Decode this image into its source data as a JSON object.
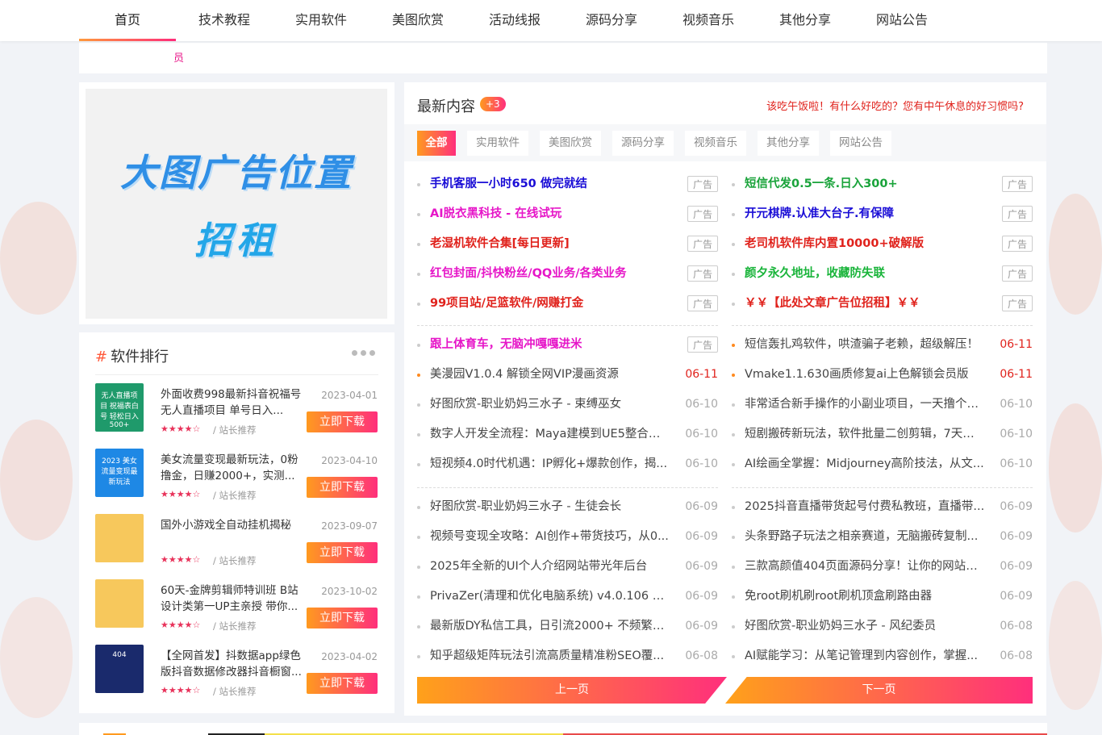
{
  "nav": {
    "items": [
      "首页",
      "技术教程",
      "实用软件",
      "美图欣赏",
      "活动线报",
      "源码分享",
      "视频音乐",
      "其他分享",
      "网站公告"
    ],
    "active_index": 0
  },
  "notice": {
    "text": "员"
  },
  "ad": {
    "line1": "大图广告位置",
    "line2": "招租"
  },
  "ranking": {
    "title": "软件排行",
    "hash": "#",
    "button_label": "立即下载",
    "stars": "★★★★☆",
    "rec_label": "/ 站长推荐",
    "items": [
      {
        "title": "外面收费998最新抖音祝福号无人直播项目 单号日入...",
        "date": "2023-04-01",
        "thumb_text": "无人直播项目 祝福表白号 轻松日入500+",
        "thumb_color": "#1f9a6b"
      },
      {
        "title": "美女流量变现最新玩法，0粉撸金，日赚2000+，实测...",
        "date": "2023-04-10",
        "thumb_text": "2023 美女流量变现最新玩法",
        "thumb_color": "#1e88e5"
      },
      {
        "title": "国外小游戏全自动挂机揭秘",
        "date": "2023-09-07",
        "thumb_text": "",
        "thumb_color": "#f7c85c"
      },
      {
        "title": "60天-金牌剪辑师特训班 B站设计类第一UP主亲授 带你...",
        "date": "2023-10-02",
        "thumb_text": "",
        "thumb_color": "#f7c85c"
      },
      {
        "title": "【全网首发】抖数据app绿色版抖音数据修改器抖音橱窗...",
        "date": "2023-04-02",
        "thumb_text": "404",
        "thumb_color": "#1a2a6c"
      }
    ]
  },
  "main": {
    "title": "最新内容",
    "badge": "+3",
    "tip": "该吃午饭啦！有什么好吃的？您有中午休息的好习惯吗?",
    "filters": [
      "全部",
      "实用软件",
      "美图欣赏",
      "源码分享",
      "视频音乐",
      "其他分享",
      "网站公告"
    ],
    "active_filter": 0,
    "ad_tag": "广告",
    "ads_left": [
      {
        "text": "手机客服一小时650 做完就结",
        "color": "#1a0dd6"
      },
      {
        "text": "AI脱衣黑科技 - 在线试玩",
        "color": "#e616c8"
      },
      {
        "text": "老湿机软件合集[每日更新]",
        "color": "#e0221c"
      },
      {
        "text": "红包封面/抖快粉丝/QQ业务/各类业务",
        "color": "#e616c8"
      },
      {
        "text": "99项目站/足篮软件/网赚打金",
        "color": "#e0221c"
      }
    ],
    "ads_right": [
      {
        "text": "短信代发0.5一条.日入300+",
        "color": "#19a33a"
      },
      {
        "text": "开元棋牌.认准大台子.有保障",
        "color": "#1a0dd6"
      },
      {
        "text": "老司机软件库内置10000+破解版",
        "color": "#e0221c"
      },
      {
        "text": "颜夕永久地址，收藏防失联",
        "color": "#19b43a"
      },
      {
        "text": "￥￥【此处文章广告位招租】￥￥",
        "color": "#e0221c"
      }
    ],
    "left_list_a": [
      {
        "text": "跟上体育车，无脑冲嘎嘎进米",
        "date": "",
        "ad": true,
        "color": "#e616c8"
      },
      {
        "text": "美漫园V1.0.4 解锁全网VIP漫画资源",
        "date": "06-11",
        "hot": true
      },
      {
        "text": "好图欣赏-职业奶妈三水子 - 束缚巫女",
        "date": "06-10"
      },
      {
        "text": "数字人开发全流程：Maya建模到UE5整合，...",
        "date": "06-10"
      },
      {
        "text": "短视频4.0时代机遇：IP孵化+爆款创作，揭...",
        "date": "06-10"
      }
    ],
    "right_list_a": [
      {
        "text": "短信轰扎鸡软件，哄渣骗子老赖，超级解压！",
        "date": "06-11",
        "hot": true
      },
      {
        "text": "Vmake1.1.630画质修复ai上色解锁会员版",
        "date": "06-11",
        "hot": true
      },
      {
        "text": "非常适合新手操作的小副业项目，一天撸个5...",
        "date": "06-10"
      },
      {
        "text": "短剧搬砖新玩法，软件批量二创剪辑，7天赚...",
        "date": "06-10"
      },
      {
        "text": "AI绘画全掌握：Midjourney高阶技法，从文...",
        "date": "06-10"
      }
    ],
    "left_list_b": [
      {
        "text": "好图欣赏-职业奶妈三水子 - 生徒会长",
        "date": "06-09"
      },
      {
        "text": "视频号变现全攻略：AI创作+带货技巧，从0...",
        "date": "06-09"
      },
      {
        "text": "2025年全新的UI个人介绍网站带光年后台",
        "date": "06-09"
      },
      {
        "text": "PrivaZer(清理和优化电脑系统) v4.0.106 多...",
        "date": "06-09"
      },
      {
        "text": "最新版DY私信工具，日引流2000+ 不频繁私...",
        "date": "06-09"
      },
      {
        "text": "知乎超级矩阵玩法引流高质量精准粉SEO覆...",
        "date": "06-08"
      }
    ],
    "right_list_b": [
      {
        "text": "2025抖音直播带货起号付费私教班，直播带...",
        "date": "06-09"
      },
      {
        "text": "头条野路子玩法之相亲赛道，无脑搬砖复制...",
        "date": "06-09"
      },
      {
        "text": "三款高颜值404页面源码分享！让你的网站「...",
        "date": "06-09"
      },
      {
        "text": "免root刷机刷root刷机顶盒刷路由器",
        "date": "06-09"
      },
      {
        "text": "好图欣赏-职业奶妈三水子 - 风纪委员",
        "date": "06-08"
      },
      {
        "text": "AI赋能学习：从笔记管理到内容创作，掌握...",
        "date": "06-08"
      }
    ],
    "pager": {
      "prev": "上一页",
      "next": "下一页"
    }
  },
  "colors": {
    "accent_start": "#ff9a1f",
    "accent_end": "#ff2f7c",
    "hot_date": "#e0221c"
  }
}
